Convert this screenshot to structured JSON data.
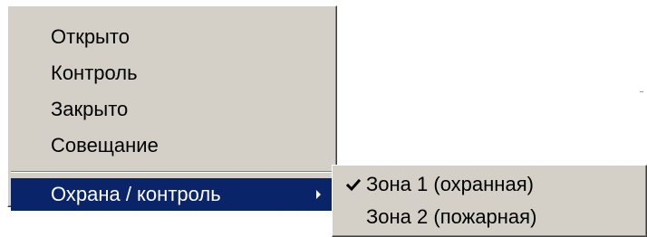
{
  "context_menu": {
    "items": [
      {
        "label": "Открыто"
      },
      {
        "label": "Контроль"
      },
      {
        "label": "Закрыто"
      },
      {
        "label": "Совещание"
      }
    ],
    "submenu_parent": {
      "label": "Охрана / контроль",
      "icon": "submenu-arrow-icon"
    }
  },
  "submenu": {
    "items": [
      {
        "label": "Зона 1 (охранная)",
        "checked": true,
        "icon": "checkmark-icon"
      },
      {
        "label": "Зона 2 (пожарная)",
        "checked": false
      }
    ]
  },
  "colors": {
    "menu_background": "#d4d0c8",
    "highlight_background": "#0a246a",
    "highlight_text": "#ffffff",
    "text": "#000000"
  }
}
